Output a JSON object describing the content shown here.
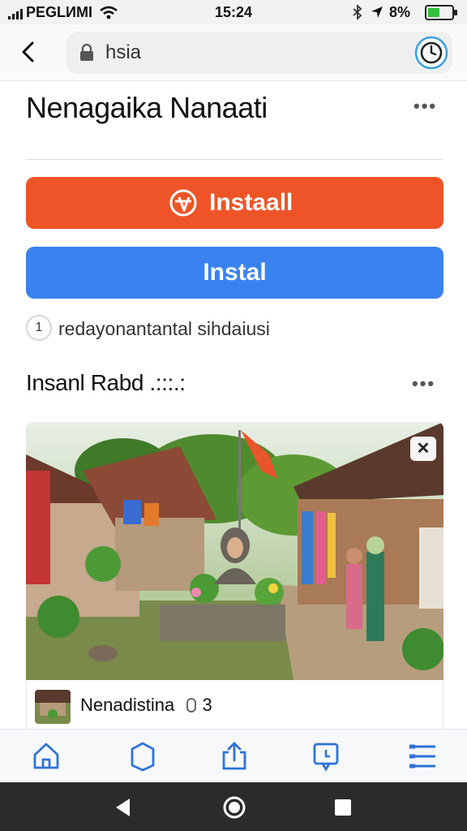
{
  "status_bar": {
    "carrier": "PEGLИMI",
    "time": "15:24",
    "battery_text": "8%"
  },
  "address_bar": {
    "url": "hsia",
    "icons": [
      "back-arrow-icon",
      "lock-icon",
      "timer-icon"
    ]
  },
  "page": {
    "title": "Nenagaika Nanaati",
    "install_primary": "Instaall",
    "install_secondary": "Instal",
    "info_badge": "1",
    "info_text": "redayonantantal sihdaiusi",
    "section_title": "Insanl Rabd .:::.:",
    "photo_close": "✕",
    "caption": "Nenadistina",
    "caption_count": "3"
  },
  "colors": {
    "install_primary": "#ee5428",
    "install_secondary": "#3a82f0",
    "toolbar_icon": "#2f73d8"
  },
  "toolbar": {
    "icons": [
      "home-icon",
      "bookmark-icon",
      "share-icon",
      "tabs-icon",
      "menu-icon"
    ]
  },
  "nav_bar": {
    "icons": [
      "back-triangle-icon",
      "home-circle-icon",
      "recents-square-icon"
    ]
  }
}
